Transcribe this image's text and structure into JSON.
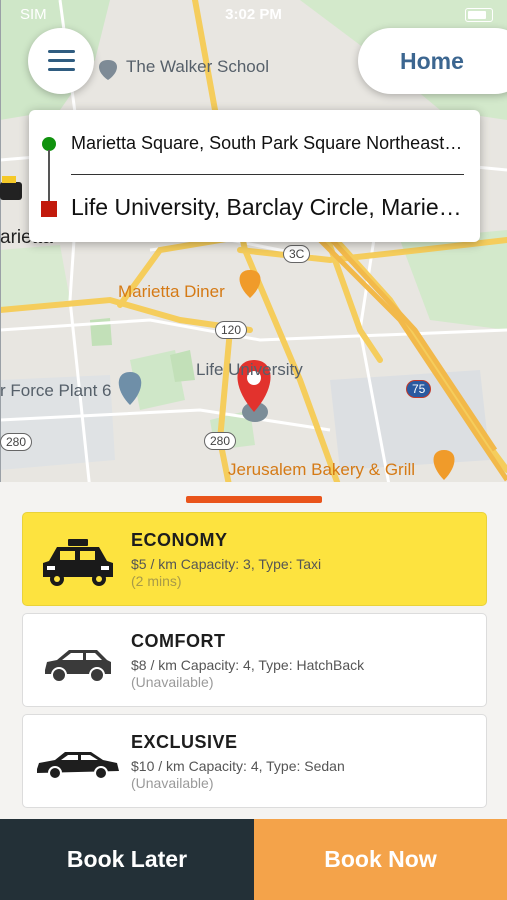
{
  "status_bar": {
    "carrier": "SIM",
    "time": "3:02 PM"
  },
  "header": {
    "menu_icon": "hamburger-icon",
    "home_label": "Home"
  },
  "route": {
    "from": "Marietta Square, South Park Square Northeast, Marietta",
    "to": "Life University, Barclay Circle, Marietta"
  },
  "map": {
    "labels": {
      "walker_school": "The Walker School",
      "marietta": "arietta",
      "marietta_diner": "Marietta Diner",
      "life_university": "Life University",
      "air_force_plant": "r Force Plant 6",
      "jerusalem_bakery": "Jerusalem Bakery & Grill"
    },
    "shields": {
      "r3c": "3C",
      "r120": "120",
      "r280a": "280",
      "r280b": "280",
      "r75": "75"
    }
  },
  "ride_options": [
    {
      "name": "ECONOMY",
      "details": "$5 / km  Capacity: 3, Type: Taxi",
      "eta": "(2 mins)",
      "icon": "taxi-icon",
      "selected": true
    },
    {
      "name": "COMFORT",
      "details": "$8 / km  Capacity: 4, Type: HatchBack",
      "eta": "(Unavailable)",
      "icon": "hatchback-icon",
      "selected": false
    },
    {
      "name": "EXCLUSIVE",
      "details": "$10 / km  Capacity: 4, Type: Sedan",
      "eta": "(Unavailable)",
      "icon": "sedan-icon",
      "selected": false
    }
  ],
  "actions": {
    "book_later": "Book Later",
    "book_now": "Book Now"
  },
  "colors": {
    "selected_bg": "#fde33f",
    "book_later_bg": "#233037",
    "book_now_bg": "#f4a34a",
    "accent_bar": "#e9541b",
    "origin_dot": "#10920e",
    "destination_square": "#c21a0c"
  }
}
